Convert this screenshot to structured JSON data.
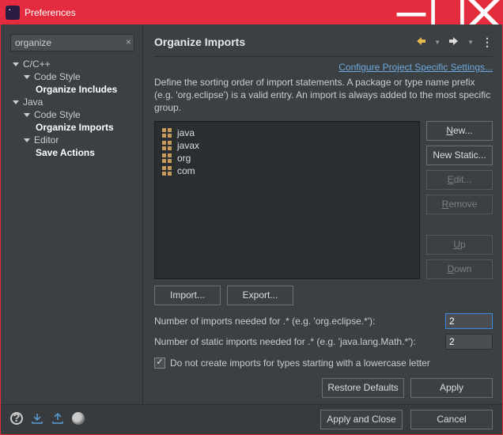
{
  "window": {
    "title": "Preferences"
  },
  "search": {
    "value": "organize",
    "clear": "×"
  },
  "tree": {
    "ccpp": "C/C++",
    "ccpp_codestyle": "Code Style",
    "ccpp_org": "Organize Includes",
    "java": "Java",
    "java_codestyle": "Code Style",
    "java_org": "Organize Imports",
    "java_editor": "Editor",
    "java_save": "Save Actions"
  },
  "page": {
    "title": "Organize Imports",
    "link": "Configure Project Specific Settings...",
    "description": "Define the sorting order of import statements. A package or type name prefix (e.g. 'org.eclipse') is a valid entry. An import is always added to the most specific group.",
    "entries": [
      "java",
      "javax",
      "org",
      "com"
    ],
    "buttons": {
      "new": "New...",
      "new_static": "New Static...",
      "edit": "Edit...",
      "remove": "Remove",
      "up": "Up",
      "down": "Down",
      "import": "Import...",
      "export": "Export..."
    },
    "imports_label": "Number of imports needed for .* (e.g. 'org.eclipse.*'):",
    "imports_value": "2",
    "static_label": "Number of static imports needed for .* (e.g. 'java.lang.Math.*'):",
    "static_value": "2",
    "lowercase_label": "Do not create imports for types starting with a lowercase letter",
    "restore": "Restore Defaults",
    "apply": "Apply"
  },
  "footer": {
    "apply_close": "Apply and Close",
    "cancel": "Cancel"
  }
}
